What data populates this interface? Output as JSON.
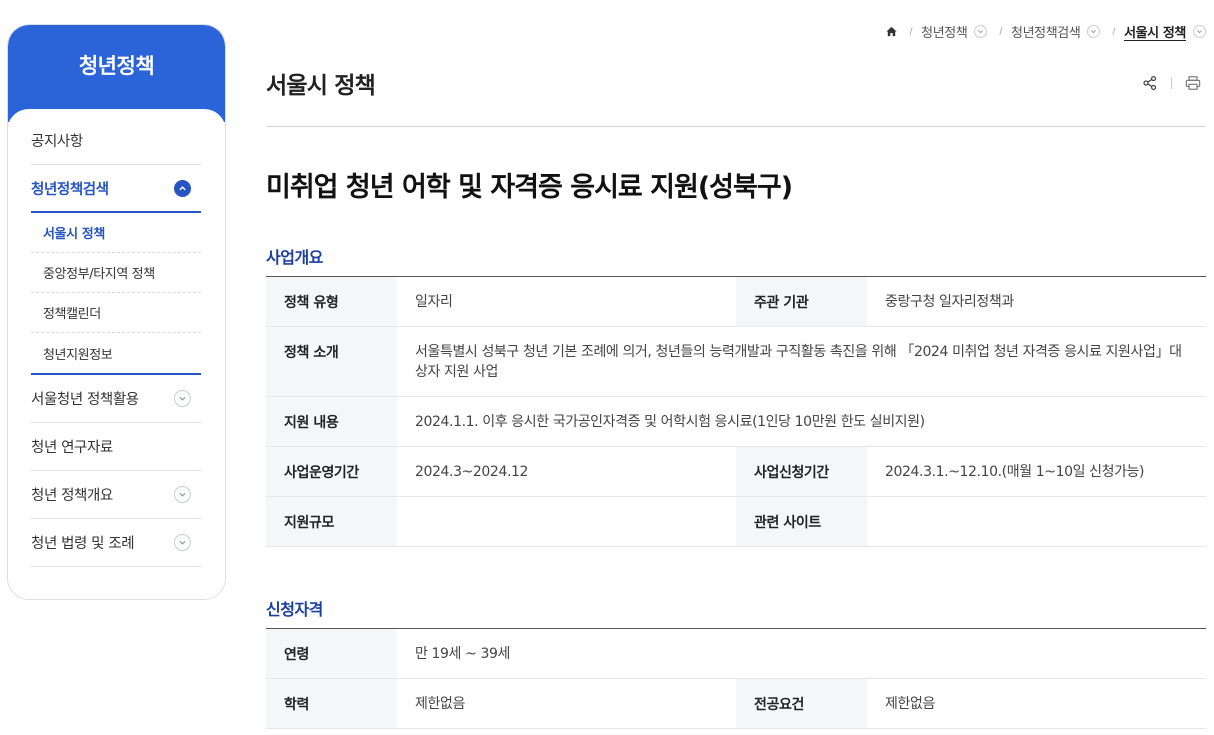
{
  "sidebar": {
    "title": "청년정책",
    "menu": [
      {
        "label": "공지사항"
      },
      {
        "label": "청년정책검색",
        "sub": [
          {
            "label": "서울시 정책"
          },
          {
            "label": "중앙정부/타지역 정책"
          },
          {
            "label": "정책캘린더"
          },
          {
            "label": "청년지원정보"
          }
        ]
      },
      {
        "label": "서울청년 정책활용"
      },
      {
        "label": "청년 연구자료"
      },
      {
        "label": "청년 정책개요"
      },
      {
        "label": "청년 법령 및 조례"
      }
    ]
  },
  "breadcrumb": {
    "home_icon": "home-icon",
    "items": [
      "청년정책",
      "청년정책검색",
      "서울시 정책"
    ]
  },
  "page": {
    "title": "서울시 정책",
    "share_icon": "share-icon",
    "print_icon": "print-icon"
  },
  "policy": {
    "title": "미취업 청년 어학 및 자격증 응시료 지원(성북구)"
  },
  "overview": {
    "heading": "사업개요",
    "policy_type_label": "정책 유형",
    "policy_type": "일자리",
    "agency_label": "주관 기관",
    "agency": "중랑구청 일자리정책과",
    "intro_label": "정책 소개",
    "intro": "서울특별시 성북구 청년 기본 조례에 의거, 청년들의 능력개발과 구직활동 촉진을 위해 「2024 미취업 청년 자격증 응시료 지원사업」대상자 지원 사업",
    "support_label": "지원 내용",
    "support": "2024.1.1. 이후 응시한 국가공인자격증 및 어학시험 응시료(1인당 10만원 한도 실비지원)",
    "period_label": "사업운영기간",
    "period": "2024.3~2024.12",
    "apply_period_label": "사업신청기간",
    "apply_period": "2024.3.1.~12.10.(매월 1~10일 신청가능)",
    "scale_label": "지원규모",
    "scale": "",
    "site_label": "관련 사이트",
    "site": ""
  },
  "eligibility": {
    "heading": "신청자격",
    "age_label": "연령",
    "age": "만 19세 ~ 39세",
    "education_label": "학력",
    "education": "제한없음",
    "major_label": "전공요건",
    "major": "제한없음"
  },
  "colors": {
    "primary": "#2b63d9",
    "accent_text": "#2654c4",
    "section_heading": "#1d3fa0"
  }
}
